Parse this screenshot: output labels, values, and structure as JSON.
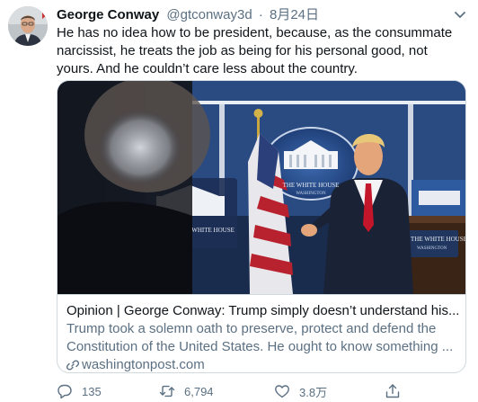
{
  "tweet": {
    "author_name": "George Conway",
    "handle": "@gtconway3d",
    "separator": "·",
    "date": "8月24日",
    "text": "He has no idea how to be president, because, as the consummate narcissist, he treats the job as being for his personal good, not yours. And he couldn’t care less about the country."
  },
  "card": {
    "title": "Opinion | George Conway: Trump simply doesn’t understand his...",
    "description_line1": "Trump took a solemn oath to preserve, protect and defend the",
    "description_line2": "Constitution of the United States. He ought to know something ...",
    "domain": "washingtonpost.com",
    "image_sign_text": "THE WHITE HOUSE",
    "image_sign_subtext": "WASHINGTON",
    "image_seal_text": "THE WHITE HOUSE",
    "image_seal_subtext": "WASHINGTON"
  },
  "actions": {
    "reply_count": "135",
    "retweet_count": "6,794",
    "like_count": "3.8万"
  },
  "colors": {
    "secondary_text": "#5b7083",
    "border": "#cfd9de",
    "backdrop_blue": "#2b4f8c"
  }
}
